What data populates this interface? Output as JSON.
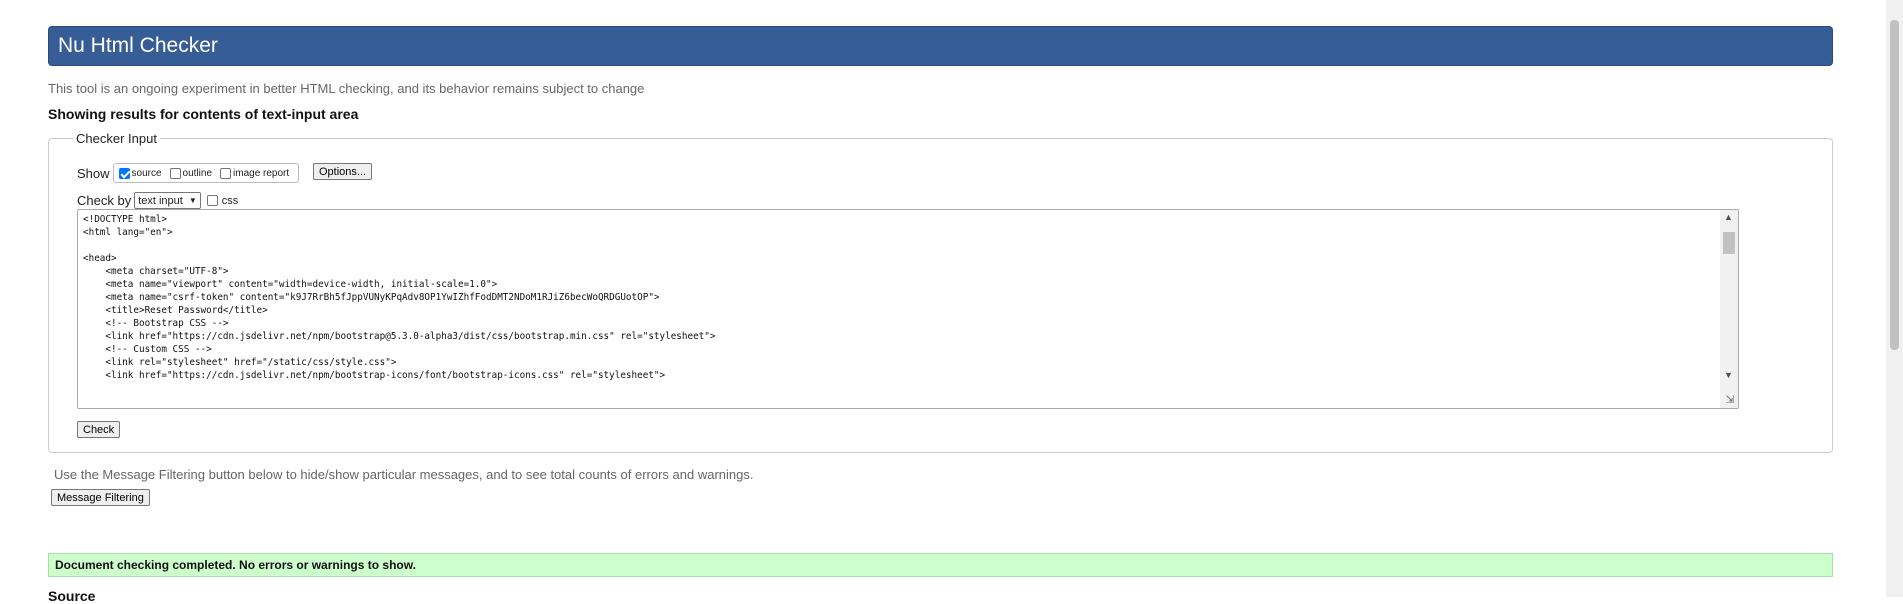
{
  "header": {
    "title": "Nu Html Checker"
  },
  "tagline": "This tool is an ongoing experiment in better HTML checking, and its behavior remains subject to change",
  "showing": "Showing results for contents of text-input area",
  "checker": {
    "legend": "Checker Input",
    "show_label": "Show",
    "show_options": [
      {
        "label": "source",
        "checked": true
      },
      {
        "label": "outline",
        "checked": false
      },
      {
        "label": "image report",
        "checked": false
      }
    ],
    "options_button": "Options...",
    "checkby_label": "Check by",
    "checkby_value": "text input",
    "css_label": "css",
    "css_checked": false,
    "code_lines": [
      "<!DOCTYPE html>",
      "<html lang=\"en\">",
      "",
      "<head>",
      "    <meta charset=\"UTF-8\">",
      "    <meta name=\"viewport\" content=\"width=device-width, initial-scale=1.0\">",
      "    <meta name=\"csrf-token\" content=\"k9J7RrBh5fJppVUNyKPqAdv8OP1YwIZhfFodDMT2NDoM1RJiZ6becWoQRDGUotOP\">",
      "    <title>Reset Password</title>",
      "    <!-- Bootstrap CSS -->",
      "    <link href=\"https://cdn.jsdelivr.net/npm/bootstrap@5.3.0-alpha3/dist/css/bootstrap.min.css\" rel=\"stylesheet\">",
      "    <!-- Custom CSS -->",
      "    <link rel=\"stylesheet\" href=\"/static/css/style.css\">",
      "    <link href=\"https://cdn.jsdelivr.net/npm/bootstrap-icons/font/bootstrap-icons.css\" rel=\"stylesheet\">"
    ],
    "check_button": "Check"
  },
  "filter": {
    "text": "Use the Message Filtering button below to hide/show particular messages, and to see total counts of errors and warnings.",
    "button": "Message Filtering"
  },
  "result": {
    "message": "Document checking completed. No errors or warnings to show."
  },
  "source_heading": "Source",
  "colors": {
    "header_bg": "#365d95",
    "success_bg": "#ccffcc",
    "checkbox_checked": "#0075ff"
  },
  "icons": {
    "scroll_up": "triangle-up-icon",
    "scroll_down": "triangle-down-icon",
    "resize": "resize-grip-icon"
  }
}
